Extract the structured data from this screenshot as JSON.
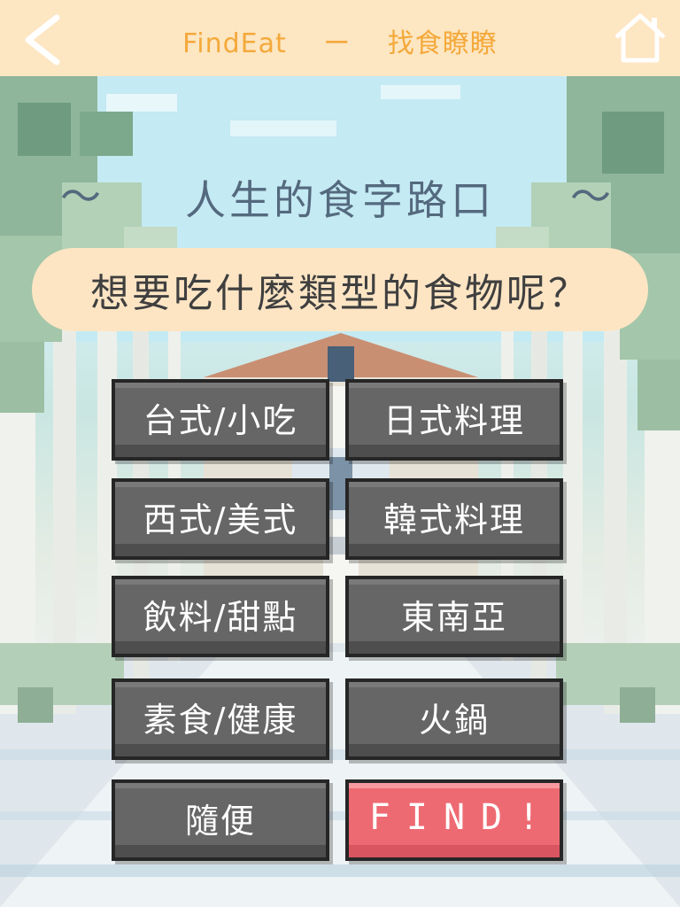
{
  "header": {
    "title": "FindEat　 ー　 找食瞭瞭",
    "background": "#fde6c2",
    "title_color": "#f4a93b",
    "back_icon": "chevron-left-icon",
    "home_icon": "home-icon"
  },
  "subtitle": {
    "text": "人生的食字路口",
    "tilde_left": "～",
    "tilde_right": "～"
  },
  "question": "想要吃什麼類型的食物呢？",
  "categories": [
    {
      "label": "台式/小吃"
    },
    {
      "label": "日式料理"
    },
    {
      "label": "西式/美式"
    },
    {
      "label": "韓式料理"
    },
    {
      "label": "飲料/甜點"
    },
    {
      "label": "東南亞"
    },
    {
      "label": "素食/健康"
    },
    {
      "label": "火鍋"
    },
    {
      "label": "隨便"
    }
  ],
  "find_button": {
    "label": "FIND!"
  },
  "colors": {
    "button": "#666666",
    "find_button": "#ee6a72",
    "subtitle_text": "#54697e",
    "question_bubble": "#fde5c4"
  }
}
